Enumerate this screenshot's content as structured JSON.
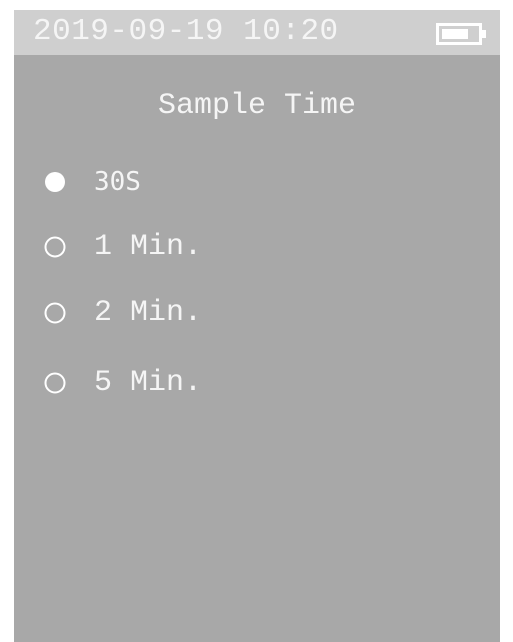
{
  "status_bar": {
    "datetime": "2019-09-19 10:20",
    "battery_icon": "battery-icon"
  },
  "screen": {
    "title": "Sample Time"
  },
  "options": [
    {
      "label": "30S",
      "selected": true
    },
    {
      "label": "1 Min.",
      "selected": false
    },
    {
      "label": "2 Min.",
      "selected": false
    },
    {
      "label": "5 Min.",
      "selected": false
    }
  ],
  "colors": {
    "screen_background": "#a8a8a8",
    "status_bar_background": "#cfcfcf",
    "text": "#f5f5f5"
  }
}
